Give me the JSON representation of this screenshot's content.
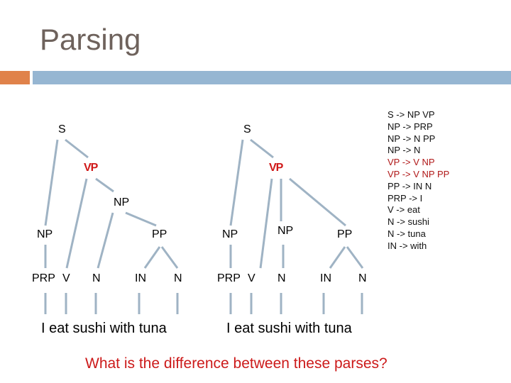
{
  "slide": {
    "title": "Parsing",
    "accent_colors": {
      "orange": "#e0824a",
      "blue": "#96b6d2",
      "highlight_red": "#d01818",
      "tree_line": "#9fb3c4"
    }
  },
  "tree_left": {
    "nodes": {
      "s": "S",
      "vp": "VP",
      "np_obj": "NP",
      "np_subj": "NP",
      "pp": "PP",
      "prp": "PRP",
      "v": "V",
      "n1": "N",
      "in": "IN",
      "n2": "N"
    },
    "sentence": "I eat sushi with tuna"
  },
  "tree_right": {
    "nodes": {
      "s": "S",
      "vp": "VP",
      "np_subj": "NP",
      "np_obj": "NP",
      "pp": "PP",
      "prp": "PRP",
      "v": "V",
      "n1": "N",
      "in": "IN",
      "n2": "N"
    },
    "sentence": "I eat sushi with tuna"
  },
  "grammar": {
    "rules": [
      {
        "text": "S -> NP  VP",
        "highlight": false
      },
      {
        "text": "NP -> PRP",
        "highlight": false
      },
      {
        "text": "NP -> N PP",
        "highlight": false
      },
      {
        "text": "NP -> N",
        "highlight": false
      },
      {
        "text": "VP -> V NP",
        "highlight": true
      },
      {
        "text": "VP -> V NP PP",
        "highlight": true
      },
      {
        "text": "PP -> IN N",
        "highlight": false
      },
      {
        "text": "PRP -> I",
        "highlight": false
      },
      {
        "text": "V -> eat",
        "highlight": false
      },
      {
        "text": "N -> sushi",
        "highlight": false
      },
      {
        "text": "N -> tuna",
        "highlight": false
      },
      {
        "text": "IN -> with",
        "highlight": false
      }
    ]
  },
  "question": "What is the difference between these parses?"
}
